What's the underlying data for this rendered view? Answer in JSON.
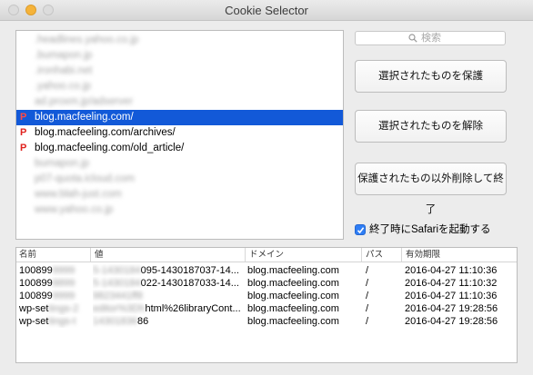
{
  "window": {
    "title": "Cookie Selector"
  },
  "cookie_list": [
    {
      "host": ".headlines.yahoo.co.jp",
      "protected": false,
      "blurred": true,
      "selected": false
    },
    {
      "host": ".bumapon.jp",
      "protected": false,
      "blurred": true,
      "selected": false
    },
    {
      "host": ".ironhabi.net",
      "protected": false,
      "blurred": true,
      "selected": false
    },
    {
      "host": ".yahoo.co.jp",
      "protected": false,
      "blurred": true,
      "selected": false
    },
    {
      "host": "ad.proxm.jp/adserver",
      "protected": false,
      "blurred": true,
      "selected": false
    },
    {
      "host": "blog.macfeeling.com/",
      "protected": true,
      "blurred": false,
      "selected": true
    },
    {
      "host": "blog.macfeeling.com/archives/",
      "protected": true,
      "blurred": false,
      "selected": false
    },
    {
      "host": "blog.macfeeling.com/old_article/",
      "protected": true,
      "blurred": false,
      "selected": false
    },
    {
      "host": "bumapon.jp",
      "protected": false,
      "blurred": true,
      "selected": false
    },
    {
      "host": "p07-quota.icloud.com",
      "protected": false,
      "blurred": true,
      "selected": false
    },
    {
      "host": "www.blah-just.com",
      "protected": false,
      "blurred": true,
      "selected": false
    },
    {
      "host": "www.yahoo.co.jp",
      "protected": false,
      "blurred": true,
      "selected": false
    }
  ],
  "protected_marker": "P",
  "search": {
    "placeholder": "検索"
  },
  "buttons": {
    "protect_label": "選択されたものを保護",
    "unprotect_label": "選択されたものを解除",
    "delete_quit_label": "保護されたもの以外削除して終了"
  },
  "launch_safari": {
    "label": "終了時にSafariを起動する",
    "checked": true
  },
  "table": {
    "headers": {
      "name": "名前",
      "value": "値",
      "domain": "ドメイン",
      "path": "パス",
      "expires": "有効期限"
    },
    "rows": [
      {
        "name": "100899",
        "name_blur": "9999",
        "value_blur": "5-1430184",
        "value": "095-1430187037-14...",
        "domain": "blog.macfeeling.com",
        "path": "/",
        "expires": "2016-04-27 11:10:36"
      },
      {
        "name": "100899",
        "name_blur": "8899",
        "value_blur": "5-1430184",
        "value": "022-1430187033-14...",
        "domain": "blog.macfeeling.com",
        "path": "/",
        "expires": "2016-04-27 11:10:32"
      },
      {
        "name": "100899",
        "name_blur": "9999",
        "value_blur": "9823441ff8",
        "value": "",
        "domain": "blog.macfeeling.com",
        "path": "/",
        "expires": "2016-04-27 11:10:36"
      },
      {
        "name": "wp-set",
        "name_blur": "tings-2",
        "value_blur": "editor%3Dh",
        "value": "html%26libraryCont...",
        "domain": "blog.macfeeling.com",
        "path": "/",
        "expires": "2016-04-27 19:28:56"
      },
      {
        "name": "wp-set",
        "name_blur": "tings-t",
        "value_blur": "14301836",
        "value": "86",
        "domain": "blog.macfeeling.com",
        "path": "/",
        "expires": "2016-04-27 19:28:56"
      }
    ]
  }
}
